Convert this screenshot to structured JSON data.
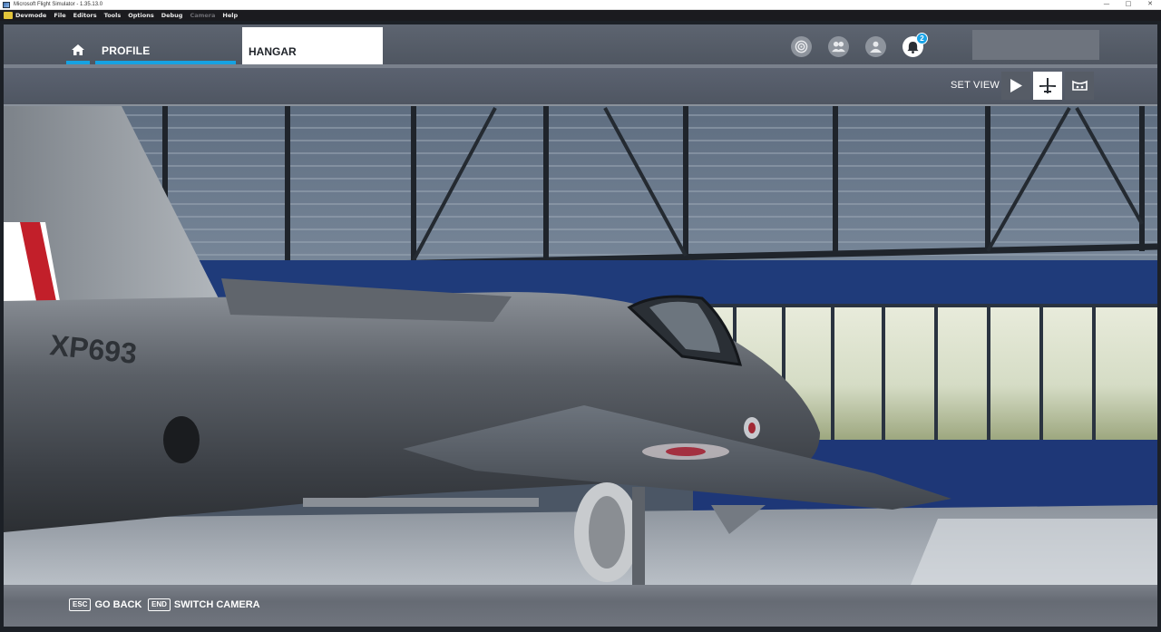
{
  "window": {
    "title": "Microsoft Flight Simulator - 1.35.13.0"
  },
  "devmode_menu": {
    "items": [
      {
        "label": "Devmode",
        "enabled": true
      },
      {
        "label": "File",
        "enabled": true
      },
      {
        "label": "Editors",
        "enabled": true
      },
      {
        "label": "Tools",
        "enabled": true
      },
      {
        "label": "Options",
        "enabled": true
      },
      {
        "label": "Debug",
        "enabled": true
      },
      {
        "label": "Camera",
        "enabled": false
      },
      {
        "label": "Help",
        "enabled": true
      }
    ]
  },
  "header": {
    "tabs": {
      "profile": "PROFILE",
      "hangar": "HANGAR"
    },
    "active_tab": "hangar",
    "notifications_count": "2",
    "accent_color": "#16a2e2"
  },
  "view_bar": {
    "label": "SET VIEW",
    "buttons": [
      {
        "name": "play-icon",
        "active": false
      },
      {
        "name": "airplane-icon",
        "active": true
      },
      {
        "name": "cockpit-view-icon",
        "active": false
      }
    ]
  },
  "scene": {
    "aircraft_registration": "XP693"
  },
  "footer": {
    "hints": [
      {
        "key": "ESC",
        "label": "GO BACK"
      },
      {
        "key": "END",
        "label": "SWITCH CAMERA"
      }
    ]
  }
}
